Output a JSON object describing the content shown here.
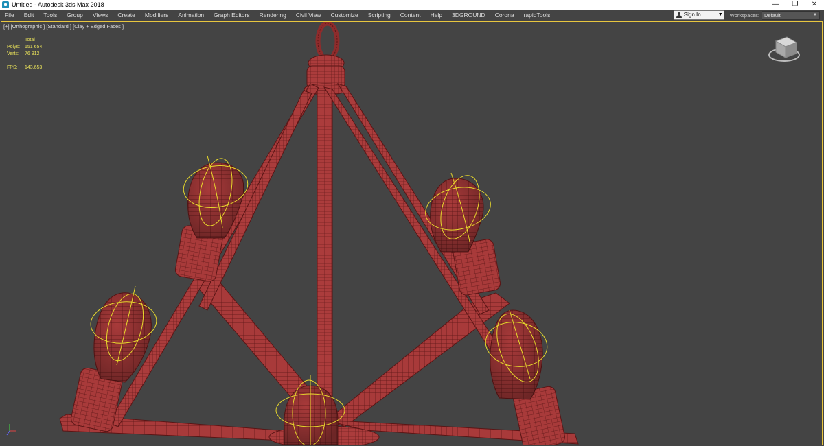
{
  "window": {
    "title": "Untitled - Autodesk 3ds Max 2018",
    "minimize_glyph": "—",
    "restore_glyph": "❐",
    "close_glyph": "✕"
  },
  "menubar": {
    "items": [
      "File",
      "Edit",
      "Tools",
      "Group",
      "Views",
      "Create",
      "Modifiers",
      "Animation",
      "Graph Editors",
      "Rendering",
      "Civil View",
      "Customize",
      "Scripting",
      "Content",
      "Help",
      "3DGROUND",
      "Corona",
      "rapidTools"
    ],
    "signin_label": "Sign In",
    "workspaces_label": "Workspaces:",
    "workspaces_value": "Default"
  },
  "viewport": {
    "label": "[+] [Orthographic ] [Standard ] [Clay + Edged Faces ]",
    "stats": {
      "total_label": "Total",
      "polys_label": "Polys:",
      "polys_value": "151 654",
      "verts_label": "Verts:",
      "verts_value": "76 912",
      "fps_label": "FPS:",
      "fps_value": "143,653"
    },
    "icons": [
      "viewcube-icon",
      "axis-tripod-icon"
    ]
  },
  "colors": {
    "viewport_bg": "#444444",
    "active_border": "#e8c63f",
    "model": "#a83a3a",
    "model_dark": "#6e1e1e",
    "gizmo": "#e8d92c",
    "stats_text": "#e8e05a"
  }
}
